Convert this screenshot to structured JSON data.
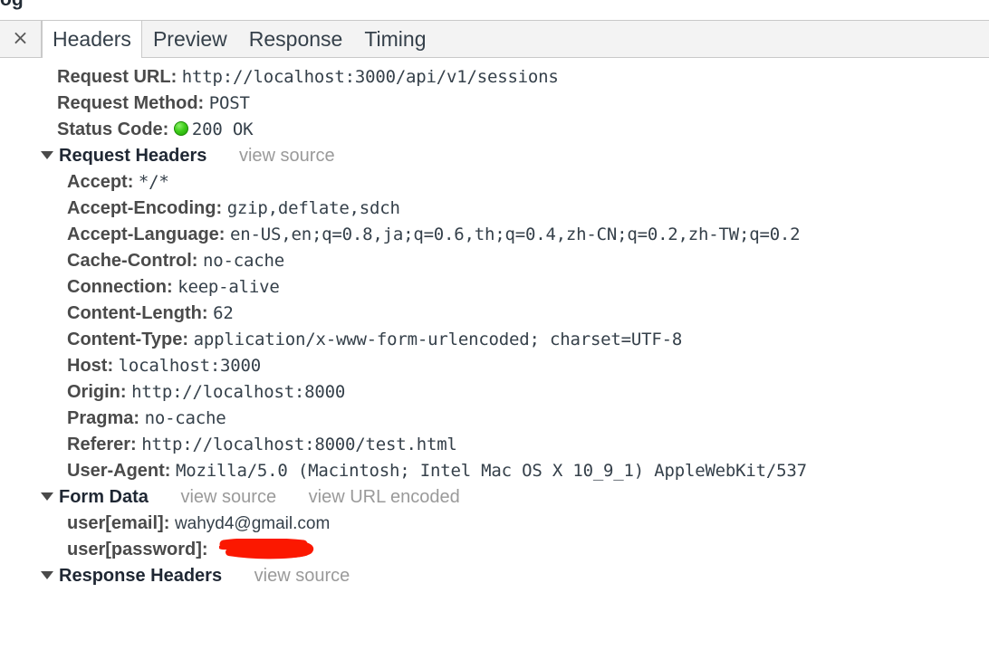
{
  "cutoff_top_text": "og",
  "tabbar": {
    "close_icon": "close-icon",
    "close_glyph": "×",
    "tabs": [
      {
        "label": "Headers",
        "selected": true
      },
      {
        "label": "Preview",
        "selected": false
      },
      {
        "label": "Response",
        "selected": false
      },
      {
        "label": "Timing",
        "selected": false
      }
    ]
  },
  "summary": {
    "request_url_label": "Request URL:",
    "request_url_value": "http://localhost:3000/api/v1/sessions",
    "request_method_label": "Request Method:",
    "request_method_value": "POST",
    "status_code_label": "Status Code:",
    "status_code_value": "200 OK",
    "status_dot_color": "#3fce1b"
  },
  "request_headers": {
    "title": "Request Headers",
    "view_source_label": "view source",
    "expanded": true,
    "items": [
      {
        "name": "Accept:",
        "value": "*/*"
      },
      {
        "name": "Accept-Encoding:",
        "value": "gzip,deflate,sdch"
      },
      {
        "name": "Accept-Language:",
        "value": "en-US,en;q=0.8,ja;q=0.6,th;q=0.4,zh-CN;q=0.2,zh-TW;q=0.2"
      },
      {
        "name": "Cache-Control:",
        "value": "no-cache"
      },
      {
        "name": "Connection:",
        "value": "keep-alive"
      },
      {
        "name": "Content-Length:",
        "value": "62"
      },
      {
        "name": "Content-Type:",
        "value": "application/x-www-form-urlencoded; charset=UTF-8"
      },
      {
        "name": "Host:",
        "value": "localhost:3000"
      },
      {
        "name": "Origin:",
        "value": "http://localhost:8000"
      },
      {
        "name": "Pragma:",
        "value": "no-cache"
      },
      {
        "name": "Referer:",
        "value": "http://localhost:8000/test.html"
      },
      {
        "name": "User-Agent:",
        "value": "Mozilla/5.0 (Macintosh; Intel Mac OS X 10_9_1) AppleWebKit/537"
      }
    ]
  },
  "form_data": {
    "title": "Form Data",
    "view_source_label": "view source",
    "view_url_encoded_label": "view URL encoded",
    "expanded": true,
    "items": [
      {
        "name": "user[email]:",
        "value": "wahyd4@gmail.com",
        "redacted": false
      },
      {
        "name": "user[password]:",
        "value": "",
        "redacted": true
      }
    ],
    "redaction_color": "#fb1800"
  },
  "response_headers": {
    "title": "Response Headers",
    "view_source_label": "view source"
  }
}
